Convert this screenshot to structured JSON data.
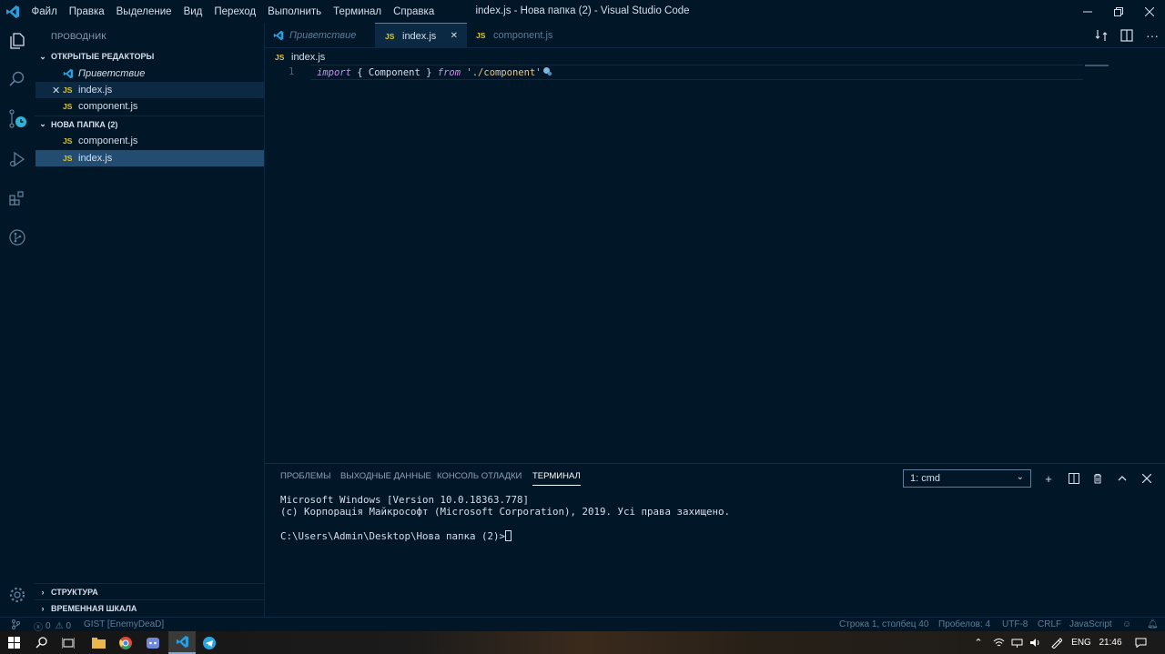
{
  "window": {
    "title": "index.js - Нова папка (2) - Visual Studio Code",
    "menu": [
      "Файл",
      "Правка",
      "Выделение",
      "Вид",
      "Переход",
      "Выполнить",
      "Терминал",
      "Справка"
    ]
  },
  "activity_bar": {
    "items": [
      "files-icon",
      "search-icon",
      "source-control-icon",
      "run-debug-icon",
      "extensions-icon",
      "git-graph-icon"
    ],
    "bottom": [
      "settings-gear-icon"
    ]
  },
  "sidebar": {
    "title": "ПРОВОДНИК",
    "open_editors": {
      "label": "ОТКРЫТЫЕ РЕДАКТОРЫ",
      "items": [
        {
          "label": "Приветствие",
          "icon": "vscode-icon"
        },
        {
          "label": "index.js",
          "badge": "JS"
        },
        {
          "label": "component.js",
          "badge": "JS"
        }
      ]
    },
    "folder": {
      "label": "НОВА ПАПКА (2)",
      "items": [
        {
          "label": "component.js",
          "badge": "JS"
        },
        {
          "label": "index.js",
          "badge": "JS"
        }
      ]
    },
    "outline_label": "СТРУКТУРА",
    "timeline_label": "ВРЕМЕННАЯ ШКАЛА"
  },
  "tabs": [
    {
      "label": "Приветствие",
      "icon": "vscode-icon"
    },
    {
      "label": "index.js",
      "badge": "JS",
      "active": true
    },
    {
      "label": "component.js",
      "badge": "JS"
    }
  ],
  "breadcrumb": {
    "badge": "JS",
    "file": "index.js"
  },
  "editor": {
    "line_number": "1",
    "code": {
      "kw_import": "import",
      "open_brace": " { ",
      "ident": "Component",
      "close_brace": " } ",
      "kw_from": "from",
      "string": "'./component'"
    }
  },
  "panel": {
    "tabs": [
      "ПРОБЛЕМЫ",
      "ВЫХОДНЫЕ ДАННЫЕ",
      "КОНСОЛЬ ОТЛАДКИ",
      "ТЕРМИНАЛ"
    ],
    "terminal_select": "1: cmd",
    "terminal_lines": [
      "Microsoft Windows [Version 10.0.18363.778]",
      "(c) Корпорація Майкрософт (Microsoft Corporation), 2019. Усі права захищено."
    ],
    "prompt": "C:\\Users\\Admin\\Desktop\\Нова папка (2)>"
  },
  "status_bar": {
    "errors": "0",
    "warnings": "0",
    "gist": "GIST [EnemyDeaD]",
    "position": "Строка 1, столбец 40",
    "spaces": "Пробелов: 4",
    "encoding": "UTF-8",
    "eol": "CRLF",
    "language": "JavaScript"
  },
  "taskbar": {
    "language": "ENG",
    "time": "21:46"
  },
  "colors": {
    "background": "#011627",
    "selection": "#234d70",
    "js_badge": "#d8c53c",
    "keyword": "#c792ea",
    "string": "#ecc48d"
  }
}
